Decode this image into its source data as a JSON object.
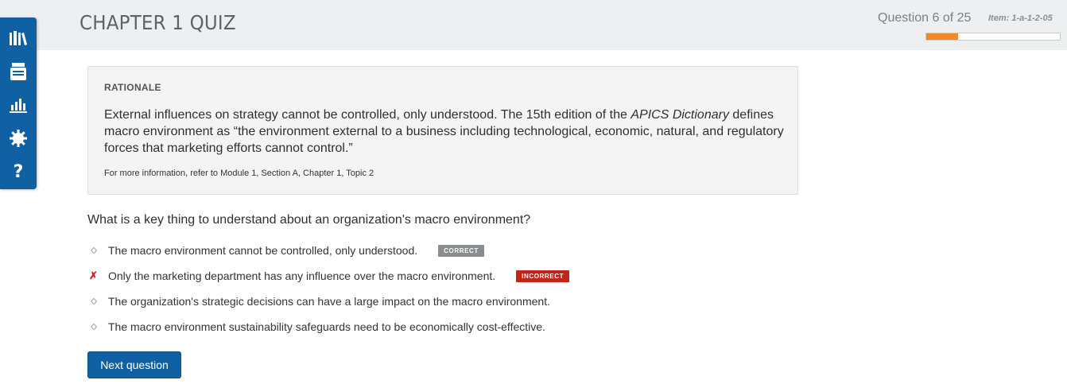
{
  "header": {
    "title": "CHAPTER 1 QUIZ",
    "question_counter": "Question 6 of 25",
    "item_id": "Item: 1-a-1-2-05",
    "progress_percent": 24,
    "progress_color": "#f08a24"
  },
  "sidebar": {
    "items": [
      {
        "icon": "library-icon"
      },
      {
        "icon": "flashcards-icon"
      },
      {
        "icon": "stats-icon"
      },
      {
        "icon": "settings-icon"
      },
      {
        "icon": "help-icon"
      }
    ]
  },
  "rationale": {
    "heading": "RATIONALE",
    "text_before": "External influences on strategy cannot be controlled, only understood. The 15th edition of the ",
    "text_italic": "APICS Dictionary",
    "text_after": " defines macro environment as “the environment external to a business including technological, economic, natural, and regulatory forces that marketing efforts cannot control.”",
    "reference": "For more information, refer to Module 1, Section A, Chapter 1, Topic 2"
  },
  "question": {
    "text": "What is a key thing to understand about an organization's macro environment?",
    "options": [
      {
        "text": "The macro environment cannot be controlled, only understood.",
        "badge": "CORRECT"
      },
      {
        "text": "Only the marketing department has any influence over the macro environment.",
        "badge": "INCORRECT",
        "selected_wrong": true
      },
      {
        "text": "The organization's strategic decisions can have a large impact on the macro environment."
      },
      {
        "text": "The macro environment sustainability safeguards need to be economically cost-effective."
      }
    ]
  },
  "next_button": {
    "label": "Next question"
  },
  "colors": {
    "brand_blue": "#0f61a4",
    "correct_badge": "#8a8d90",
    "incorrect_badge": "#c3231c"
  }
}
